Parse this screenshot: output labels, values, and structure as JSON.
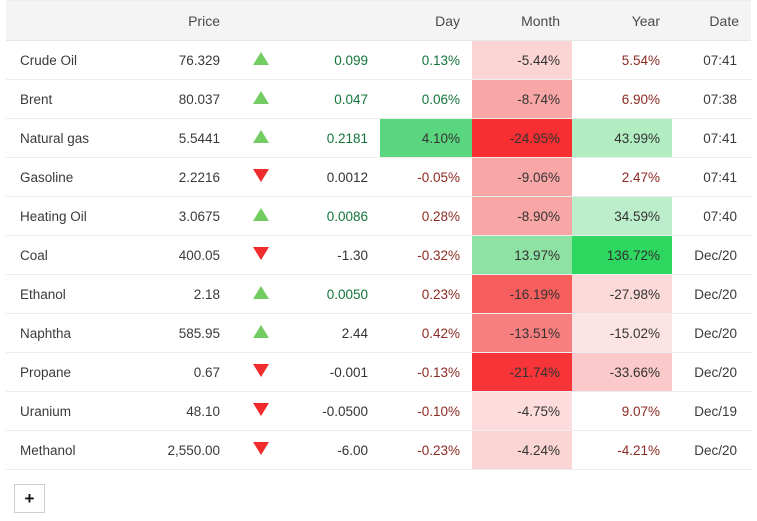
{
  "table": {
    "headers": {
      "name": "",
      "price": "Price",
      "arrow": "",
      "change": "",
      "day": "Day",
      "month": "Month",
      "year": "Year",
      "date": "Date"
    },
    "rows": [
      {
        "name": "Crude Oil",
        "price": "76.329",
        "direction": "up",
        "change": "0.099",
        "change_sign": "pos",
        "day": "0.13%",
        "day_sign": "pos",
        "day_bg": "",
        "day_fg": "",
        "month": "-5.44%",
        "month_sign": "neg",
        "month_bg": "#fbd4d4",
        "month_fg": "#333333",
        "year": "5.54%",
        "year_sign": "neg",
        "year_bg": "",
        "year_fg": "",
        "date": "07:41"
      },
      {
        "name": "Brent",
        "price": "80.037",
        "direction": "up",
        "change": "0.047",
        "change_sign": "pos",
        "day": "0.06%",
        "day_sign": "pos",
        "day_bg": "",
        "day_fg": "",
        "month": "-8.74%",
        "month_sign": "neg",
        "month_bg": "#f9a6a6",
        "month_fg": "#333333",
        "year": "6.90%",
        "year_sign": "neg",
        "year_bg": "",
        "year_fg": "",
        "date": "07:38"
      },
      {
        "name": "Natural gas",
        "price": "5.5441",
        "direction": "up",
        "change": "0.2181",
        "change_sign": "pos",
        "day": "4.10%",
        "day_sign": "neg",
        "day_bg": "#5ad67f",
        "day_fg": "#333333",
        "month": "-24.95%",
        "month_sign": "neg",
        "month_bg": "#f72f32",
        "month_fg": "#333333",
        "year": "43.99%",
        "year_sign": "neg",
        "year_bg": "#b2edc2",
        "year_fg": "#333333",
        "date": "07:41"
      },
      {
        "name": "Gasoline",
        "price": "2.2216",
        "direction": "down",
        "change": "0.0012",
        "change_sign": "neg",
        "day": "-0.05%",
        "day_sign": "neg",
        "day_bg": "",
        "day_fg": "",
        "month": "-9.06%",
        "month_sign": "neg",
        "month_bg": "#f9a6a6",
        "month_fg": "#333333",
        "year": "2.47%",
        "year_sign": "neg",
        "year_bg": "",
        "year_fg": "",
        "date": "07:41"
      },
      {
        "name": "Heating Oil",
        "price": "3.0675",
        "direction": "up",
        "change": "0.0086",
        "change_sign": "pos",
        "day": "0.28%",
        "day_sign": "neg",
        "day_bg": "",
        "day_fg": "",
        "month": "-8.90%",
        "month_sign": "neg",
        "month_bg": "#f9a6a6",
        "month_fg": "#333333",
        "year": "34.59%",
        "year_sign": "neg",
        "year_bg": "#bdeecb",
        "year_fg": "#333333",
        "date": "07:40"
      },
      {
        "name": "Coal",
        "price": "400.05",
        "direction": "down",
        "change": "-1.30",
        "change_sign": "neg",
        "day": "-0.32%",
        "day_sign": "neg",
        "day_bg": "",
        "day_fg": "",
        "month": "13.97%",
        "month_sign": "neg",
        "month_bg": "#8ee2a3",
        "month_fg": "#333333",
        "year": "136.72%",
        "year_sign": "neg",
        "year_bg": "#2ed760",
        "year_fg": "#333333",
        "date": "Dec/20"
      },
      {
        "name": "Ethanol",
        "price": "2.18",
        "direction": "up",
        "change": "0.0050",
        "change_sign": "pos",
        "day": "0.23%",
        "day_sign": "neg",
        "day_bg": "",
        "day_fg": "",
        "month": "-16.19%",
        "month_sign": "neg",
        "month_bg": "#f75f5f",
        "month_fg": "#333333",
        "year": "-27.98%",
        "year_sign": "neg",
        "year_bg": "#fcdada",
        "year_fg": "#333333",
        "date": "Dec/20"
      },
      {
        "name": "Naphtha",
        "price": "585.95",
        "direction": "up",
        "change": "2.44",
        "change_sign": "neg",
        "day": "0.42%",
        "day_sign": "neg",
        "day_bg": "",
        "day_fg": "",
        "month": "-13.51%",
        "month_sign": "neg",
        "month_bg": "#f77f7f",
        "month_fg": "#333333",
        "year": "-15.02%",
        "year_sign": "neg",
        "year_bg": "#fce4e4",
        "year_fg": "#333333",
        "date": "Dec/20"
      },
      {
        "name": "Propane",
        "price": "0.67",
        "direction": "down",
        "change": "-0.001",
        "change_sign": "neg",
        "day": "-0.13%",
        "day_sign": "neg",
        "day_bg": "",
        "day_fg": "",
        "month": "-21.74%",
        "month_sign": "neg",
        "month_bg": "#f73538",
        "month_fg": "#333333",
        "year": "-33.66%",
        "year_sign": "neg",
        "year_bg": "#fbc9c9",
        "year_fg": "#333333",
        "date": "Dec/20"
      },
      {
        "name": "Uranium",
        "price": "48.10",
        "direction": "down",
        "change": "-0.0500",
        "change_sign": "neg",
        "day": "-0.10%",
        "day_sign": "neg",
        "day_bg": "",
        "day_fg": "",
        "month": "-4.75%",
        "month_sign": "neg",
        "month_bg": "#fcdcdc",
        "month_fg": "#333333",
        "year": "9.07%",
        "year_sign": "neg",
        "year_bg": "",
        "year_fg": "",
        "date": "Dec/19"
      },
      {
        "name": "Methanol",
        "price": "2,550.00",
        "direction": "down",
        "change": "-6.00",
        "change_sign": "neg",
        "day": "-0.23%",
        "day_sign": "neg",
        "day_bg": "",
        "day_fg": "",
        "month": "-4.24%",
        "month_sign": "neg",
        "month_bg": "#fbd4d4",
        "month_fg": "#333333",
        "year": "-4.21%",
        "year_sign": "neg",
        "year_bg": "",
        "year_fg": "",
        "date": "Dec/20"
      }
    ]
  },
  "footer": {
    "add_label": "+"
  },
  "colors": {
    "positive_text": "#13753a",
    "negative_text": "#8c2b23",
    "arrow_up": "#73cc62",
    "arrow_down": "#ef2b2b",
    "header_bg": "#f4f4f4",
    "row_border": "#ececed"
  }
}
